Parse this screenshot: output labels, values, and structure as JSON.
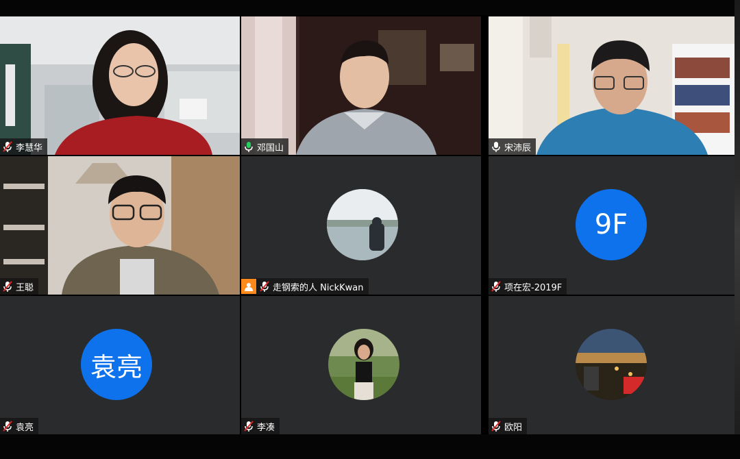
{
  "participants": [
    {
      "name": "李慧华",
      "muted": true,
      "video": true
    },
    {
      "name": "邓国山",
      "muted": false,
      "video": true,
      "active_speaker": true
    },
    {
      "name": "宋沛辰",
      "muted": false,
      "video": true
    },
    {
      "name": "王聪",
      "muted": true,
      "video": true
    },
    {
      "name": "走钢索的人 NickKwan",
      "muted": true,
      "video": false,
      "avatar": "photo-lake"
    },
    {
      "name": "项在宏-2019F",
      "muted": true,
      "video": false,
      "initials": "9F"
    },
    {
      "name": "袁亮",
      "muted": true,
      "video": false,
      "initials": "袁亮"
    },
    {
      "name": "李凑",
      "muted": true,
      "video": false,
      "avatar": "photo-woman"
    },
    {
      "name": "欧阳",
      "muted": true,
      "video": false,
      "avatar": "photo-city"
    }
  ],
  "colors": {
    "active_border": "#23d160",
    "avatar_blue": "#0e72ed",
    "muted_red": "#e02828",
    "tile_bg": "#2a2b2d"
  },
  "icons": {
    "muted": "mic-muted-icon",
    "unmuted": "mic-icon",
    "host": "host-badge-icon"
  }
}
